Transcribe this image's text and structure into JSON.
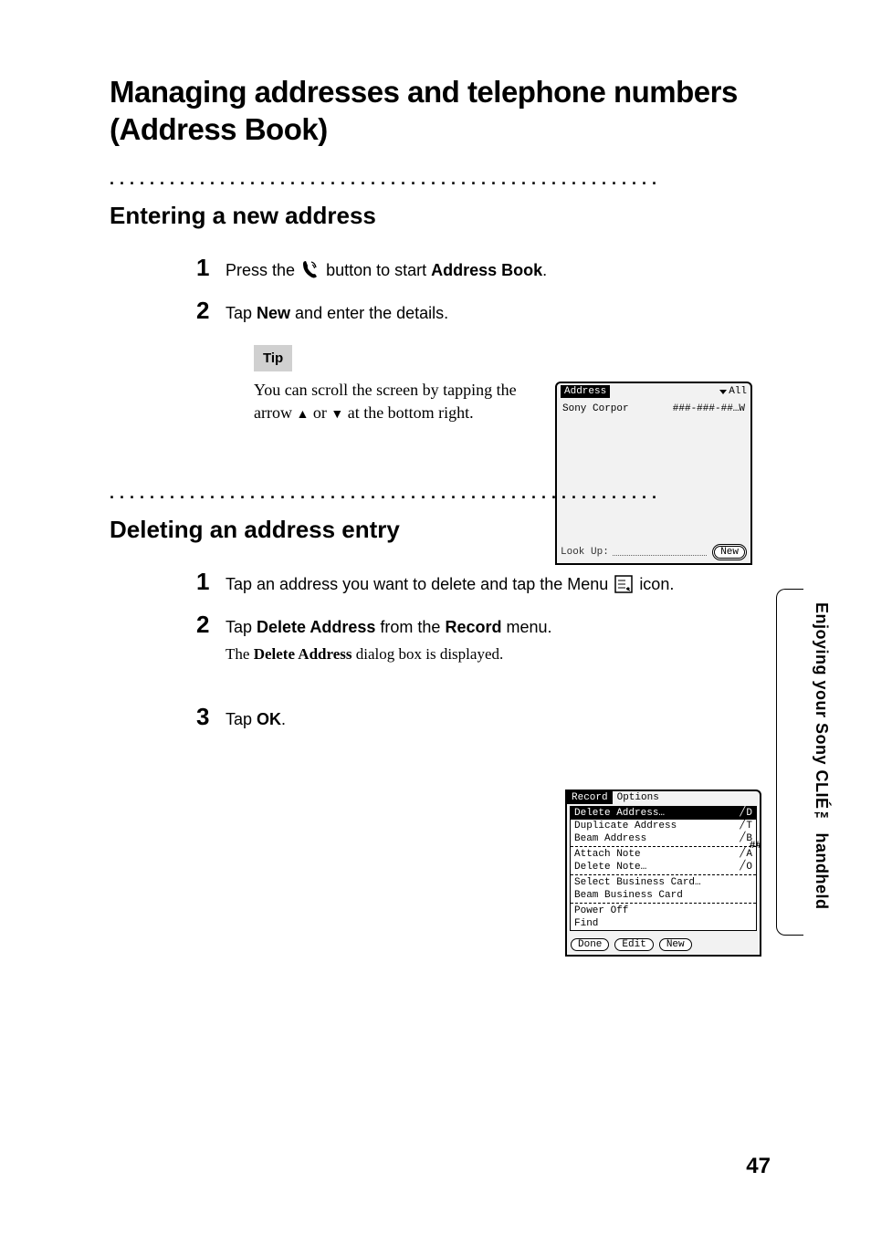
{
  "main_title": "Managing addresses and telephone numbers (Address Book)",
  "section1": {
    "title": "Entering a new address",
    "step1_pre": "Press the ",
    "step1_post": " button to start ",
    "step1_app": "Address Book",
    "step1_end": ".",
    "step2_pre": "Tap ",
    "step2_new": "New",
    "step2_post": " and enter the details.",
    "tip_label": "Tip",
    "tip_text_1": "You can scroll the screen by tapping the arrow ",
    "tip_text_2": " or ",
    "tip_text_3": " at the bottom right."
  },
  "screenshot1": {
    "title": "Address",
    "category": "All",
    "entry_name": "Sony Corpor",
    "entry_phone": "###-###-##…W",
    "lookup": "Look Up:",
    "new_btn": "New"
  },
  "section2": {
    "title": "Deleting an address entry",
    "step1_pre": "Tap an address you want to delete and tap the Menu ",
    "step1_post": " icon.",
    "step2_pre": "Tap ",
    "step2_delete": "Delete Address",
    "step2_mid": " from the ",
    "step2_record": "Record",
    "step2_post": " menu.",
    "step2_sub_pre": "The ",
    "step2_sub_bold": "Delete Address",
    "step2_sub_post": " dialog box is displayed.",
    "step3_pre": "Tap ",
    "step3_ok": "OK",
    "step3_post": "."
  },
  "screenshot2": {
    "tab_record": "Record",
    "tab_options": "Options",
    "menu_items": [
      {
        "label": "Delete Address…",
        "shortcut": "D",
        "selected": true
      },
      {
        "label": "Duplicate Address",
        "shortcut": "T",
        "selected": false
      },
      {
        "label": "Beam Address",
        "shortcut": "B",
        "selected": false
      }
    ],
    "menu_group2": [
      {
        "label": "Attach Note",
        "shortcut": "A"
      },
      {
        "label": "Delete Note…",
        "shortcut": "O"
      }
    ],
    "menu_group3": [
      {
        "label": "Select Business Card…"
      },
      {
        "label": "Beam Business Card"
      }
    ],
    "menu_group4": [
      {
        "label": "Power Off"
      },
      {
        "label": "Find"
      }
    ],
    "side_hash": "##",
    "btn_done": "Done",
    "btn_edit": "Edit",
    "btn_new": "New"
  },
  "side_tab": "Enjoying your Sony CLIÉ™ handheld",
  "page_number": "47"
}
